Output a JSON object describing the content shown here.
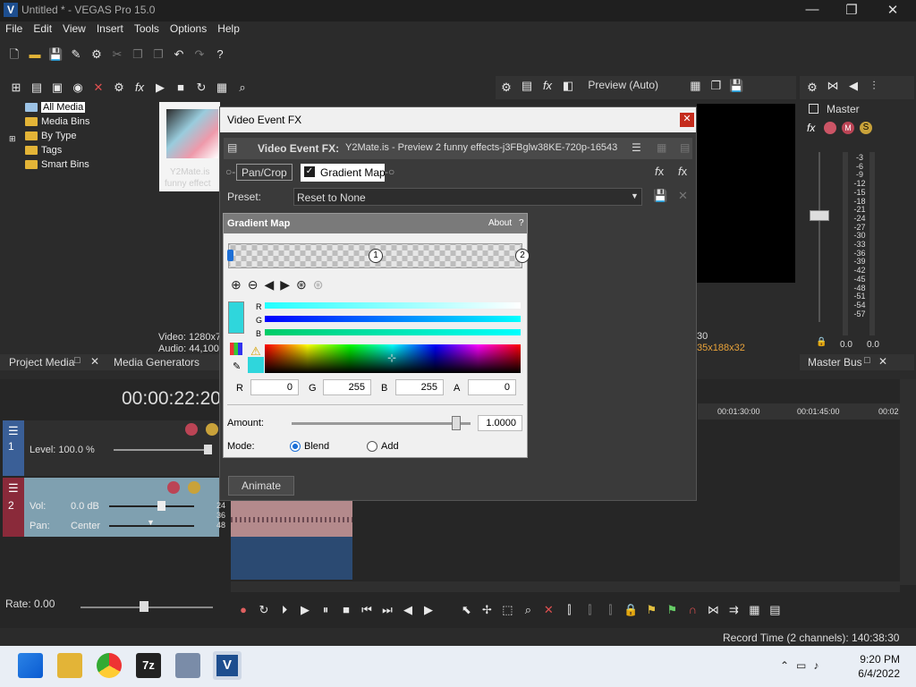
{
  "window": {
    "title": "Untitled * - VEGAS Pro 15.0",
    "minimize": "—",
    "maximize": "❐",
    "close": "✕"
  },
  "menu": [
    "File",
    "Edit",
    "View",
    "Insert",
    "Tools",
    "Options",
    "Help"
  ],
  "explorer": {
    "items": [
      "All Media",
      "Media Bins",
      "By Type",
      "Tags",
      "Smart Bins"
    ],
    "thumb_text": [
      "Y2Mate.is",
      "funny effect"
    ],
    "video_info": "Video: 1280x7",
    "audio_info": "Audio: 44,100"
  },
  "tabs": {
    "project_media": "Project Media",
    "media_generators": "Media Generators",
    "master_bus": "Master Bus"
  },
  "preview": {
    "label": "Preview (Auto)",
    "info_a": "30",
    "info_b": "35x188x32"
  },
  "master": {
    "label": "Master",
    "meter_scale": [
      "3",
      "6",
      "9",
      "12",
      "15",
      "18",
      "21",
      "24",
      "27",
      "30",
      "33",
      "36",
      "39",
      "42",
      "45",
      "48",
      "51",
      "54",
      "57"
    ],
    "left_val": "0.0",
    "right_val": "0.0"
  },
  "dialog": {
    "title": "Video Event FX",
    "fx_label": "Video Event FX:",
    "fx_name": "Y2Mate.is - Preview 2 funny effects-j3FBglw38KE-720p-16543",
    "chain": [
      "Pan/Crop",
      "Gradient Map"
    ],
    "preset_label": "Preset:",
    "preset_value": "Reset to None",
    "animate": "Animate"
  },
  "gradient_map": {
    "title": "Gradient Map",
    "about": "About",
    "help": "?",
    "stop_1": "1",
    "stop_2": "2",
    "channels": [
      "R",
      "G",
      "B"
    ],
    "rgba": {
      "r_label": "R",
      "r": "0",
      "g_label": "G",
      "g": "255",
      "b_label": "B",
      "b": "255",
      "a_label": "A",
      "a": "0"
    },
    "amount_label": "Amount:",
    "amount": "1.0000",
    "amount_level": 0.92,
    "mode_label": "Mode:",
    "mode_blend": "Blend",
    "mode_add": "Add",
    "selected_mode": "Blend"
  },
  "timeline": {
    "timecode": "00:00:22:20",
    "ruler": [
      "00:01:30:00",
      "00:01:45:00",
      "00:02"
    ],
    "track1": {
      "num": "1",
      "level": "Level: 100.0 %"
    },
    "track2": {
      "num": "2",
      "vol_label": "Vol:",
      "vol": "0.0 dB",
      "pan_label": "Pan:",
      "pan": "Center",
      "db_marks": [
        "24",
        "36",
        "48"
      ]
    },
    "rate": "Rate: 0.00"
  },
  "status": {
    "record_time": "Record Time (2 channels): 140:38:30"
  },
  "taskbar": {
    "time": "9:20 PM",
    "date": "6/4/2022",
    "app_7z": "7z"
  },
  "colors": {
    "accent_blue": "#1d4e8f",
    "close_red": "#c42b1c",
    "track1": "#3a5f97",
    "track2": "#8a2a3a"
  }
}
